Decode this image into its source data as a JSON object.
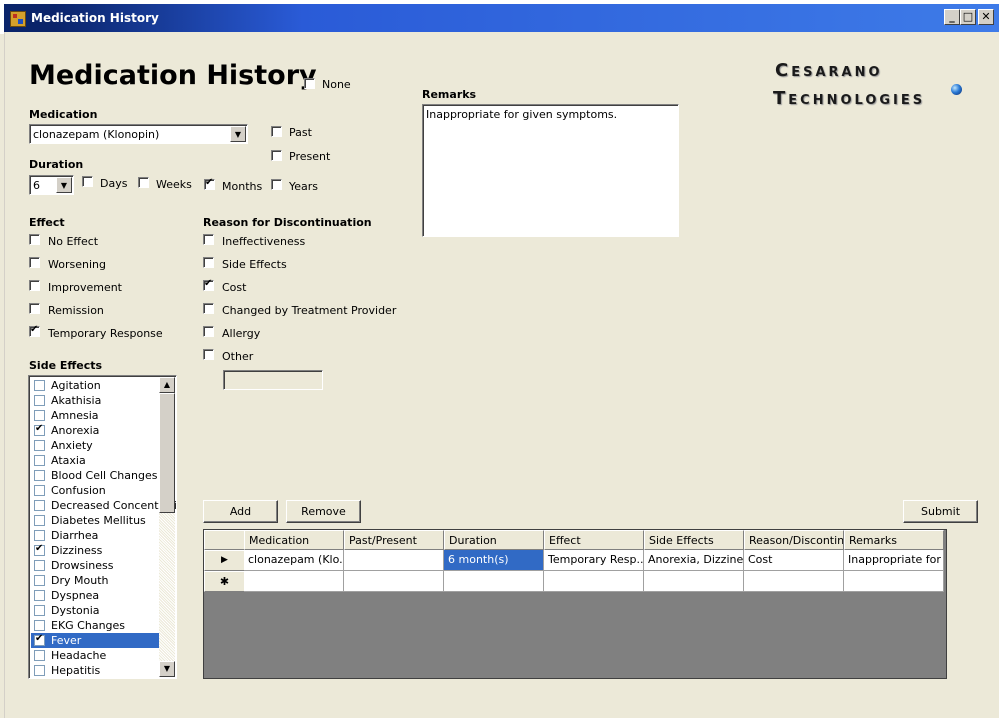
{
  "window": {
    "title": "Medication History",
    "controls": {
      "minimize": "_",
      "maximize": "□",
      "close": "✕"
    }
  },
  "header": {
    "title": "Medication History",
    "none_label": "None",
    "none_checked": false
  },
  "logo": {
    "line1": "Cesarano",
    "line2": "Technologies"
  },
  "medication": {
    "label": "Medication",
    "value": "clonazepam (Klonopin)",
    "past_label": "Past",
    "past_checked": false,
    "present_label": "Present",
    "present_checked": false
  },
  "duration": {
    "label": "Duration",
    "value": "6",
    "units": [
      {
        "label": "Days",
        "checked": false
      },
      {
        "label": "Weeks",
        "checked": false
      },
      {
        "label": "Months",
        "checked": true
      },
      {
        "label": "Years",
        "checked": false
      }
    ]
  },
  "remarks": {
    "label": "Remarks",
    "value": "Inappropriate for given symptoms."
  },
  "effect": {
    "label": "Effect",
    "options": [
      {
        "label": "No Effect",
        "checked": false
      },
      {
        "label": "Worsening",
        "checked": false
      },
      {
        "label": "Improvement",
        "checked": false
      },
      {
        "label": "Remission",
        "checked": false
      },
      {
        "label": "Temporary Response",
        "checked": true
      }
    ]
  },
  "reason": {
    "label": "Reason for Discontinuation",
    "options": [
      {
        "label": "Ineffectiveness",
        "checked": false
      },
      {
        "label": "Side Effects",
        "checked": false
      },
      {
        "label": "Cost",
        "checked": true
      },
      {
        "label": "Changed by Treatment Provider",
        "checked": false
      },
      {
        "label": "Allergy",
        "checked": false
      },
      {
        "label": "Other",
        "checked": false
      }
    ],
    "other_value": ""
  },
  "side_effects": {
    "label": "Side Effects",
    "items": [
      {
        "label": "Agitation",
        "checked": false
      },
      {
        "label": "Akathisia",
        "checked": false
      },
      {
        "label": "Amnesia",
        "checked": false
      },
      {
        "label": "Anorexia",
        "checked": true
      },
      {
        "label": "Anxiety",
        "checked": false
      },
      {
        "label": "Ataxia",
        "checked": false
      },
      {
        "label": "Blood Cell Changes",
        "checked": false
      },
      {
        "label": "Confusion",
        "checked": false
      },
      {
        "label": "Decreased Concentrati",
        "checked": false
      },
      {
        "label": "Diabetes Mellitus",
        "checked": false
      },
      {
        "label": "Diarrhea",
        "checked": false
      },
      {
        "label": "Dizziness",
        "checked": true
      },
      {
        "label": "Drowsiness",
        "checked": false
      },
      {
        "label": "Dry Mouth",
        "checked": false
      },
      {
        "label": "Dyspnea",
        "checked": false
      },
      {
        "label": "Dystonia",
        "checked": false
      },
      {
        "label": "EKG Changes",
        "checked": false
      },
      {
        "label": "Fever",
        "checked": true,
        "selected": true
      },
      {
        "label": "Headache",
        "checked": false
      },
      {
        "label": "Hepatitis",
        "checked": false
      }
    ]
  },
  "buttons": {
    "add": "Add",
    "remove": "Remove",
    "submit": "Submit"
  },
  "grid": {
    "columns": [
      "Medication",
      "Past/Present",
      "Duration",
      "Effect",
      "Side Effects",
      "Reason/Discontinu",
      "Remarks"
    ],
    "rows": [
      [
        "clonazepam (Klo...",
        "",
        "6 month(s)",
        "Temporary Resp...",
        "Anorexia, Dizzine...",
        "Cost",
        "Inappropriate for ..."
      ]
    ],
    "current_row_marker": "▶",
    "new_row_marker": "✱"
  }
}
